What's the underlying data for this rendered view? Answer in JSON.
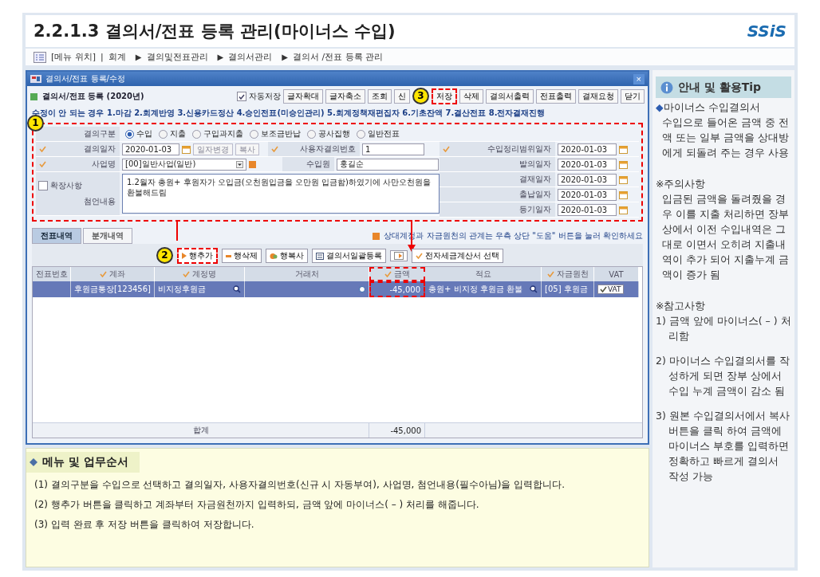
{
  "page": {
    "title": "2.2.1.3 결의서/전표 등록 관리(마이너스 수입)",
    "logo": "SSiS"
  },
  "breadcrumb": {
    "label": "[메뉴 위치]",
    "divider": "|",
    "separator": "▶",
    "items": [
      "회계",
      "결의및전표관리",
      "결의서관리",
      "결의서 /전표 등록 관리"
    ]
  },
  "window": {
    "title": "결의서/전표 등록/수정",
    "close": "×",
    "heading": "결의서/전표 등록 (2020년)",
    "autosave": {
      "label": "자동저장",
      "checked": true
    },
    "toolbar": [
      {
        "label": "글자확대",
        "highlighted": false
      },
      {
        "label": "글자축소",
        "highlighted": false
      },
      {
        "label": "조회",
        "highlighted": false
      },
      {
        "label": "신",
        "highlighted": false
      },
      {
        "label": "저장",
        "highlighted": true,
        "badge": "3"
      },
      {
        "label": "삭제",
        "highlighted": false
      },
      {
        "label": "결의서출력",
        "highlighted": false
      },
      {
        "label": "전표출력",
        "highlighted": false
      },
      {
        "label": "결재요청",
        "highlighted": false
      },
      {
        "label": "닫기",
        "highlighted": false
      }
    ],
    "notice": "수정이 안 되는 경우 1.마감 2.회계반영 3.신용카드정산 4.승인전표(미승인관리) 5.회계정책재편집자 6.기초잔액 7.결산전표 8.전자결재진행",
    "form": {
      "badge": "1",
      "highlighted": true,
      "division": {
        "label": "결의구분",
        "options": [
          {
            "label": "수입",
            "selected": true
          },
          {
            "label": "지출",
            "selected": false
          },
          {
            "label": "구입과지출",
            "selected": false
          },
          {
            "label": "보조금반납",
            "selected": false
          },
          {
            "label": "공사집행",
            "selected": false
          },
          {
            "label": "일반전표",
            "selected": false
          }
        ]
      },
      "date": {
        "label": "결의일자",
        "value": "2020-01-03",
        "required": true
      },
      "date_buttons": [
        "일자변경",
        "복사"
      ],
      "user_no": {
        "label": "사용자결의번호",
        "value": "1",
        "required": true
      },
      "project": {
        "label": "사업명",
        "value": "[00]일반사업(일반)",
        "required": true
      },
      "source": {
        "label": "수입원",
        "value": "홍길순"
      },
      "extra": {
        "label": "확장사항",
        "checked": false
      },
      "memo": {
        "label": "첨언내용",
        "value": "1.2월자 총원+ 후원자가 오입금(오천원입금을 오만원 입금함)하였기에 사만오천원을 환불해드림"
      },
      "dates": [
        {
          "label": "수입정리범위일자",
          "value": "2020-01-03",
          "required": true
        },
        {
          "label": "발의일자",
          "value": "2020-01-03",
          "required": false
        },
        {
          "label": "결재일자",
          "value": "2020-01-03",
          "required": false
        },
        {
          "label": "출납일자",
          "value": "2020-01-03",
          "required": false
        },
        {
          "label": "등기일자",
          "value": "2020-01-03",
          "required": false
        }
      ]
    },
    "tabs": [
      {
        "label": "전표내역",
        "selected": true
      },
      {
        "label": "분개내역",
        "selected": false
      }
    ],
    "hint": "상대계정과 자금원천의 관계는 우측 상단 \"도움\" 버튼을 눌러 확인하세요",
    "row_buttons": [
      {
        "kind": "add",
        "label": "행추가",
        "highlighted": true,
        "badge": "2"
      },
      {
        "kind": "delete",
        "label": "행삭제",
        "highlighted": false
      },
      {
        "kind": "copy",
        "label": "행복사",
        "highlighted": false
      },
      {
        "kind": "batch",
        "label": "결의서일괄등록",
        "highlighted": false
      },
      {
        "kind": "icon",
        "highlighted": false
      },
      {
        "kind": "tax",
        "label": "전자세금계산서 선택",
        "highlighted": false
      }
    ],
    "table": {
      "columns": [
        {
          "label": "전표번호",
          "required": false,
          "highlighted": false
        },
        {
          "label": "계좌",
          "required": true,
          "highlighted": false
        },
        {
          "label": "계정명",
          "required": true,
          "highlighted": false
        },
        {
          "label": "거래처",
          "required": false,
          "highlighted": false
        },
        {
          "label": "금액",
          "required": true,
          "highlighted": true
        },
        {
          "label": "적요",
          "required": false,
          "highlighted": false
        },
        {
          "label": "자금원천",
          "required": true,
          "highlighted": false
        },
        {
          "label": "VAT",
          "required": false,
          "highlighted": false
        }
      ],
      "rows": [
        {
          "selected": true,
          "account": "후원금통장[123456]",
          "account_name": "비지정후원금",
          "amount": "-45,000",
          "summary": "총원+ 비지정 후원금 환불",
          "fund": "[05] 후원금",
          "vat": {
            "label": "VAT",
            "checked": true
          }
        }
      ],
      "total": {
        "label": "합계",
        "amount": "-45,000"
      }
    }
  },
  "tips": {
    "title": "안내 및 활용Tip",
    "intro": {
      "marker": "◆",
      "title": "마이너스 수입결의서",
      "body": "수입으로 들어온 금액 중 전액 또는 일부 금액을 상대방에게 되돌려 주는 경우 사용"
    },
    "caution": {
      "title": "※주의사항",
      "body": "입금된 금액을 돌려줬을 경우 이를 지출 처리하면 장부상에서 이전 수입내역은 그대로 이면서 오히려 지출내역이 추가 되어 지출누계 금액이 증가 됨"
    },
    "reference": {
      "title": "※참고사항",
      "items": [
        "1) 금액 앞에 마이너스( – ) 처리함",
        "2) 마이너스 수입결의서를 작성하게 되면 장부 상에서 수입 누계 금액이 감소 됨",
        "3) 원본 수입결의서에서 복사 버튼을 클릭 하여 금액에 마이너스 부호를 입력하면 정확하고 빠르게 결의서 작성 가능"
      ]
    }
  },
  "steps": {
    "title": "메뉴 및 업무순서",
    "items": [
      "(1) 결의구분을 수입으로 선택하고 결의일자, 사용자결의번호(신규 시 자동부여), 사업명, 첨언내용(필수아님)을 입력합니다.",
      "(2) 행추가 버튼을 클릭하고 계좌부터 자금원천까지 입력하되, 금액 앞에 마이너스( – ) 처리를 해줍니다.",
      "(3) 입력 완료 후 저장 버튼을 클릭하여 저장합니다."
    ]
  }
}
